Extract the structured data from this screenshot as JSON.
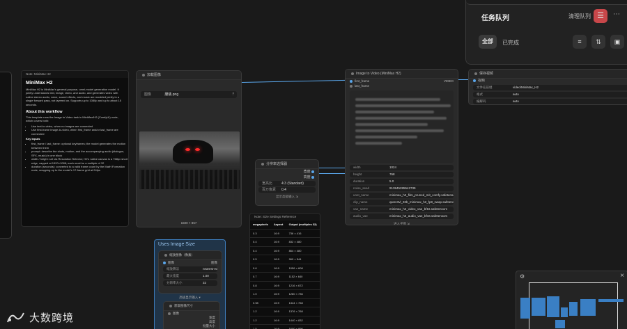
{
  "queue_panel": {
    "title": "任务队列",
    "clear_label": "清理队列",
    "filter_all": "全部",
    "filter_done": "已完成"
  },
  "note_node": {
    "header": "Note: MiniMax H2",
    "title": "MiniMax H2",
    "intro": "MiniMax H2 is MiniMax's general-purpose, omni-model generation model. It jointly understands text, image, video, and audio, and generates video with native stereo audio, voice, sound effects, and music are modeled jointly in a single forward pass, not layered on. Supports up to 1080p and up to about 15 seconds.",
    "section": "About this workflow",
    "workflow_text": "This template runs the Image to Video task in MiniMax/H2 (ComfyUI) node, which covers both:",
    "bullets": [
      "Use text-to-video, when no images are connected",
      "Use first-frame image-to-video, when first_frame and/or last_frame are connected"
    ],
    "key_inputs_title": "Key inputs",
    "key_inputs": [
      "first_frame / last_frame: optional keyframes; the model generates the motion between them",
      "prompt: describe the shots, motion, and the accompanying audio (dialogue, SFX, music) in one block",
      "width / height: set via Resolution Selector; H2's native canvas is a 768px short edge, capped at 1920×1088; each must be a multiple of 32",
      "duration (seconds): converted to a valid frame count by the MatH Formation node, snapping up to the model's 17-frame grid at 24fps"
    ]
  },
  "load_image_node": {
    "header": "加载图像",
    "field_label": "图像",
    "file_name": "服装.png",
    "size_caption": "1500 × 867"
  },
  "res_node": {
    "header": "分辨率选择器",
    "out1": "宽度",
    "out2": "高度",
    "f1_key": "宽高比",
    "f1_val": "4:3 (Standard)",
    "f2_key": "百万像素",
    "f2_val": "0.4",
    "footer": "显示高级输入"
  },
  "i2v_node": {
    "header": "Image to Video (MiniMax H2)",
    "in_first": "first_frame",
    "in_last": "last_frame",
    "out_label": "VIDEO",
    "prompt_lines": 8,
    "fields": [
      {
        "key": "width",
        "val": "1024"
      },
      {
        "key": "height",
        "val": "768"
      },
      {
        "key": "duration",
        "val": "5.0"
      },
      {
        "key": "noise_seed",
        "val": "913845285542739"
      },
      {
        "key": "unet_name",
        "val": "minimax_h2_film_pruned_mit_comfy.safetensors"
      },
      {
        "key": "clip_name",
        "val": "qwen3vl_32b_minimax_h2_fp8_swap.safetensors"
      },
      {
        "key": "vae_name",
        "val": "minimax_h2_video_vae_bf16.safetensors"
      },
      {
        "key": "audio_vae",
        "val": "minimax_h2_audio_vae_bf16.safetensors"
      }
    ],
    "footer": "进入子图"
  },
  "save_node": {
    "header": "保存视频",
    "in_label": "视频",
    "fields": [
      {
        "key": "文件名前缀",
        "val": "video/MiniMax_H2"
      },
      {
        "key": "格式",
        "val": "auto"
      },
      {
        "key": "编解码",
        "val": "auto"
      }
    ]
  },
  "ref_node": {
    "header": "Note: Size Settings Reference",
    "columns": [
      "megapixels",
      "Aspect",
      "Output (multiples 32)"
    ],
    "rows": [
      [
        "0.3",
        "16:9",
        "736 × 416"
      ],
      [
        "0.4",
        "16:9",
        "832 × 480"
      ],
      [
        "0.4",
        "16:9",
        "864 × 480"
      ],
      [
        "0.5",
        "16:9",
        "960 × 544"
      ],
      [
        "0.6",
        "16:9",
        "1056 × 608"
      ],
      [
        "0.7",
        "16:9",
        "1152 × 640"
      ],
      [
        "0.8",
        "16:9",
        "1216 × 672"
      ],
      [
        "1.0",
        "16:9",
        "1280 × 736"
      ],
      [
        "0.98",
        "16:9",
        "1344 × 768"
      ],
      [
        "1.2",
        "16:9",
        "1376 × 768"
      ],
      [
        "1.2",
        "16:9",
        "1440 × 832"
      ],
      [
        "1.5",
        "16:9",
        "1600 × 896"
      ],
      [
        "1.8",
        "16:9",
        "1792 × 1024"
      ]
    ]
  },
  "upscale_node": {
    "header": "Uses Image Size",
    "group_label": "缩放图像（像素）",
    "in_label": "图像",
    "out_label": "图像",
    "fields": [
      {
        "key": "缩放算法",
        "val": "nearest-exact"
      },
      {
        "key": "最大宽度",
        "val": "1.00"
      },
      {
        "key": "分辨率大小",
        "val": "32"
      }
    ],
    "advanced": "高级显示输入",
    "sub_label": "获取图像尺寸",
    "sub_in": "图像",
    "sub_outs": [
      "宽度",
      "高度",
      "批量大小"
    ]
  },
  "watermark": "大数跨境",
  "colors": {
    "link": "#5aa6ea",
    "accent_red": "#c8474a",
    "group_blue": "#3d7dbd"
  }
}
